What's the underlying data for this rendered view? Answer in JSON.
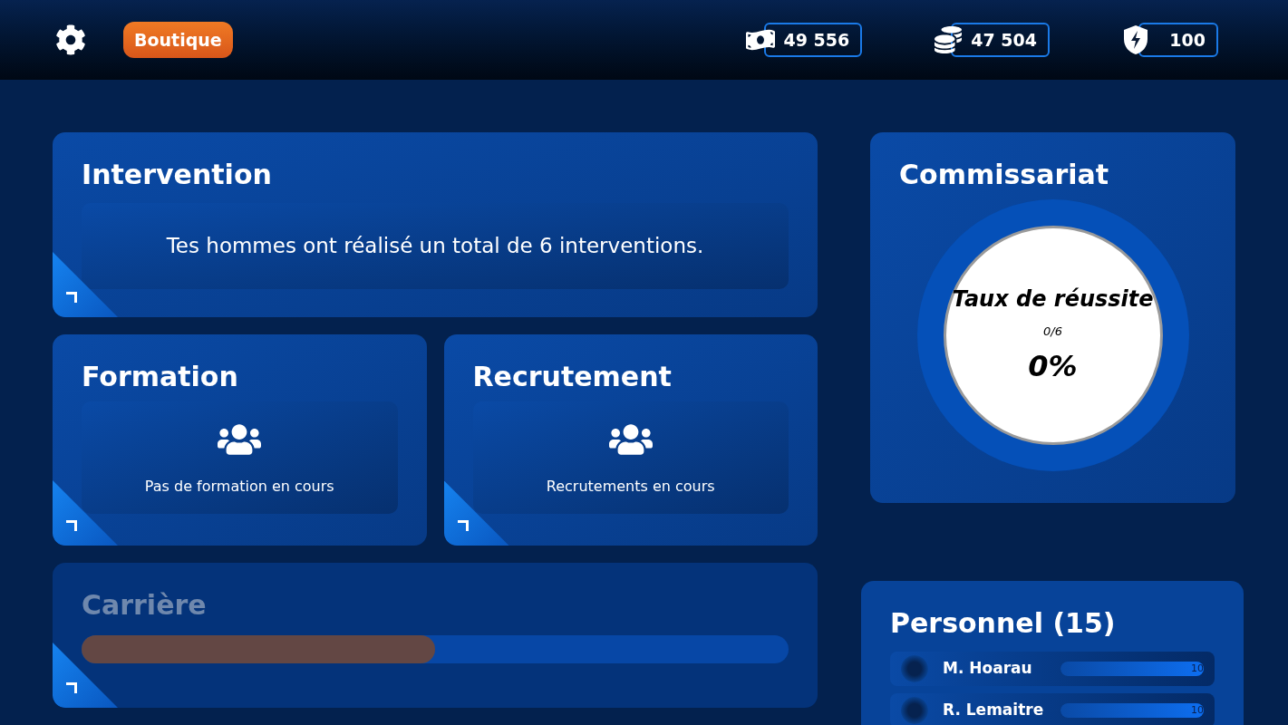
{
  "header": {
    "shop_button": "Boutique",
    "currencies": [
      {
        "kind": "money",
        "value": "49 556"
      },
      {
        "kind": "coins",
        "value": "47 504"
      },
      {
        "kind": "energy",
        "value": "100"
      }
    ]
  },
  "intervention": {
    "title": "Intervention",
    "message": "Tes hommes ont réalisé un total de 6 interventions."
  },
  "formation": {
    "title": "Formation",
    "message": "Pas de formation en cours"
  },
  "recrutement": {
    "title": "Recrutement",
    "message": "Recrutements en cours"
  },
  "carriere": {
    "title": "Carrière",
    "disabled": true,
    "level": 0.5
  },
  "commissariat": {
    "title": "Commissariat",
    "gauge_title": "Taux de réussite",
    "ratio": "0/6",
    "percent": "0%"
  },
  "personnel": {
    "title": "Personnel (15)",
    "members": [
      {
        "name": "M. Hoarau",
        "level": 1,
        "value": "10"
      },
      {
        "name": "R. Lemaitre",
        "level": 1,
        "value": "10"
      }
    ]
  }
}
